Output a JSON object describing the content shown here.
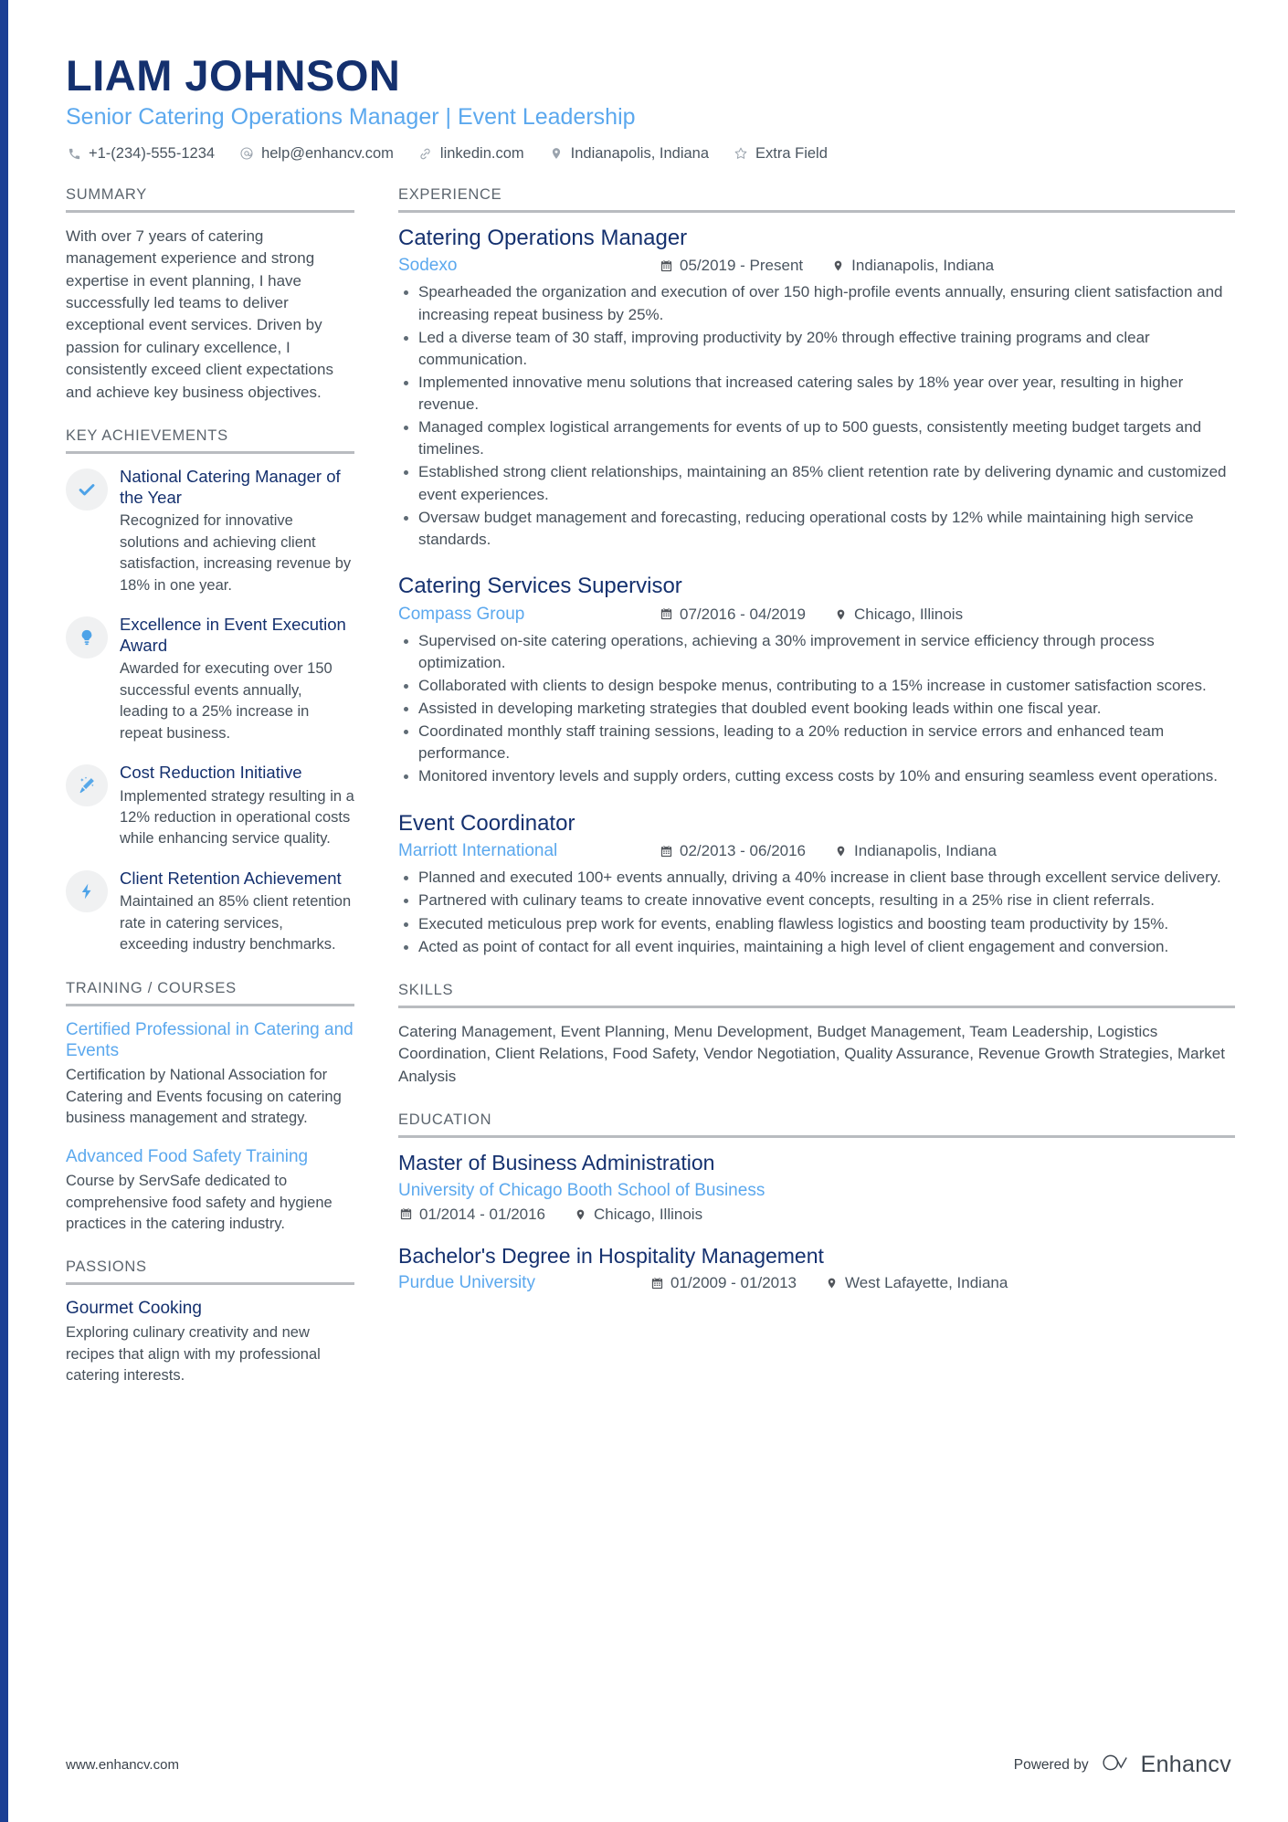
{
  "colors": {
    "navy": "#14306e",
    "light_blue": "#5ba8ee",
    "accent_bar": "#1c3f94",
    "body_text": "#46505a",
    "section_heading": "#5c656e",
    "rule": "#b9bcc0",
    "icon_circle_bg": "#f0f1f2"
  },
  "header": {
    "name": "LIAM JOHNSON",
    "tagline": "Senior Catering Operations Manager | Event Leadership",
    "contacts": [
      {
        "icon": "phone-icon",
        "text": "+1-(234)-555-1234"
      },
      {
        "icon": "email-icon",
        "text": "help@enhancv.com"
      },
      {
        "icon": "link-icon",
        "text": "linkedin.com"
      },
      {
        "icon": "location-pin-icon",
        "text": "Indianapolis, Indiana"
      },
      {
        "icon": "star-icon",
        "text": "Extra Field"
      }
    ]
  },
  "sidebar": {
    "summary": {
      "heading": "SUMMARY",
      "text": "With over 7 years of catering management experience and strong expertise in event planning, I have successfully led teams to deliver exceptional event services. Driven by passion for culinary excellence, I consistently exceed client expectations and achieve key business objectives."
    },
    "key_achievements": {
      "heading": "KEY ACHIEVEMENTS",
      "items": [
        {
          "icon": "check-icon",
          "title": "National Catering Manager of the Year",
          "description": "Recognized for innovative solutions and achieving client satisfaction, increasing revenue by 18% in one year."
        },
        {
          "icon": "lightbulb-icon",
          "title": "Excellence in Event Execution Award",
          "description": "Awarded for executing over 150 successful events annually, leading to a 25% increase in repeat business."
        },
        {
          "icon": "magic-wand-icon",
          "title": "Cost Reduction Initiative",
          "description": "Implemented strategy resulting in a 12% reduction in operational costs while enhancing service quality."
        },
        {
          "icon": "lightning-bolt-icon",
          "title": "Client Retention Achievement",
          "description": "Maintained an 85% client retention rate in catering services, exceeding industry benchmarks."
        }
      ]
    },
    "training": {
      "heading": "TRAINING / COURSES",
      "items": [
        {
          "title": "Certified Professional in Catering and Events",
          "description": "Certification by National Association for Catering and Events focusing on catering business management and strategy."
        },
        {
          "title": "Advanced Food Safety Training",
          "description": "Course by ServSafe dedicated to comprehensive food safety and hygiene practices in the catering industry."
        }
      ]
    },
    "passions": {
      "heading": "PASSIONS",
      "items": [
        {
          "title": "Gourmet Cooking",
          "description": "Exploring culinary creativity and new recipes that align with my professional catering interests."
        }
      ]
    }
  },
  "main": {
    "experience": {
      "heading": "EXPERIENCE",
      "jobs": [
        {
          "title": "Catering Operations Manager",
          "company": "Sodexo",
          "dates": "05/2019 - Present",
          "location": "Indianapolis, Indiana",
          "bullets": [
            "Spearheaded the organization and execution of over 150 high-profile events annually, ensuring client satisfaction and increasing repeat business by 25%.",
            "Led a diverse team of 30 staff, improving productivity by 20% through effective training programs and clear communication.",
            "Implemented innovative menu solutions that increased catering sales by 18% year over year, resulting in higher revenue.",
            "Managed complex logistical arrangements for events of up to 500 guests, consistently meeting budget targets and timelines.",
            "Established strong client relationships, maintaining an 85% client retention rate by delivering dynamic and customized event experiences.",
            "Oversaw budget management and forecasting, reducing operational costs by 12% while maintaining high service standards."
          ]
        },
        {
          "title": "Catering Services Supervisor",
          "company": "Compass Group",
          "dates": "07/2016 - 04/2019",
          "location": "Chicago, Illinois",
          "bullets": [
            "Supervised on-site catering operations, achieving a 30% improvement in service efficiency through process optimization.",
            "Collaborated with clients to design bespoke menus, contributing to a 15% increase in customer satisfaction scores.",
            "Assisted in developing marketing strategies that doubled event booking leads within one fiscal year.",
            "Coordinated monthly staff training sessions, leading to a 20% reduction in service errors and enhanced team performance.",
            "Monitored inventory levels and supply orders, cutting excess costs by 10% and ensuring seamless event operations."
          ]
        },
        {
          "title": "Event Coordinator",
          "company": "Marriott International",
          "dates": "02/2013 - 06/2016",
          "location": "Indianapolis, Indiana",
          "bullets": [
            "Planned and executed 100+ events annually, driving a 40% increase in client base through excellent service delivery.",
            "Partnered with culinary teams to create innovative event concepts, resulting in a 25% rise in client referrals.",
            "Executed meticulous prep work for events, enabling flawless logistics and boosting team productivity by 15%.",
            "Acted as point of contact for all event inquiries, maintaining a high level of client engagement and conversion."
          ]
        }
      ]
    },
    "skills": {
      "heading": "SKILLS",
      "text": "Catering Management, Event Planning, Menu Development, Budget Management, Team Leadership, Logistics Coordination, Client Relations, Food Safety, Vendor Negotiation, Quality Assurance, Revenue Growth Strategies, Market Analysis"
    },
    "education": {
      "heading": "EDUCATION",
      "items": [
        {
          "degree": "Master of Business Administration",
          "school": "University of Chicago Booth School of Business",
          "dates": "01/2014 - 01/2016",
          "location": "Chicago, Illinois",
          "inline": false
        },
        {
          "degree": "Bachelor's Degree in Hospitality Management",
          "school": "Purdue University",
          "dates": "01/2009 - 01/2013",
          "location": "West Lafayette, Indiana",
          "inline": true
        }
      ]
    }
  },
  "footer": {
    "url": "www.enhancv.com",
    "powered_by": "Powered by",
    "brand": "Enhancv"
  }
}
